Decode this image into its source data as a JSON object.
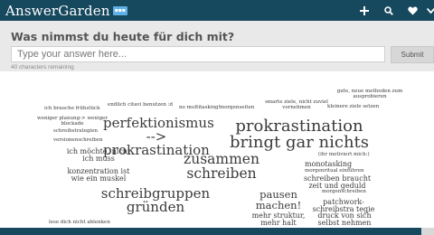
{
  "app": {
    "brand": "AnswerGarden"
  },
  "toolbar": {
    "items": [
      {
        "icon": "plus-icon"
      },
      {
        "icon": "search-icon"
      },
      {
        "icon": "heart-icon"
      },
      {
        "icon": "chevron-down-icon"
      }
    ]
  },
  "question": "Was nimmst du heute für dich mit?",
  "input": {
    "placeholder": "Type your answer here...",
    "value": ""
  },
  "submit_label": "Submit",
  "chars_remaining": "40 characters remaining",
  "cloud": {
    "words": [
      "ich brauche frühstück",
      "endlich citavi benutzen :d",
      "no multitasking!",
      "morgenseiten",
      "smarte ziele, nicht zuviel vornehmen",
      "gute, neue methoden zum ausprobieren",
      "kleinere ziele setzen",
      "weniger planung-> weniger blockade",
      "schreibstrategien",
      "versionenschreiben",
      "perfektionismus --> prokrastination",
      "prokrastination bringt gar nichts",
      "ich möchte, nicht ich muss",
      "zusammen schreiben",
      "(ihr motiviert mich:)",
      "monotasking",
      "morgenritual einführen",
      "konzentration ist wie ein muskel",
      "schreiben braucht zeit und geduld",
      "morgenschreiben",
      "schreibgruppen gründen",
      "pausen machen!",
      "patchwork-schreibstra tegie",
      "mehr struktur, mehr halt",
      "druck von sich selbst nehmen",
      "lese dich nicht ablenken"
    ]
  }
}
